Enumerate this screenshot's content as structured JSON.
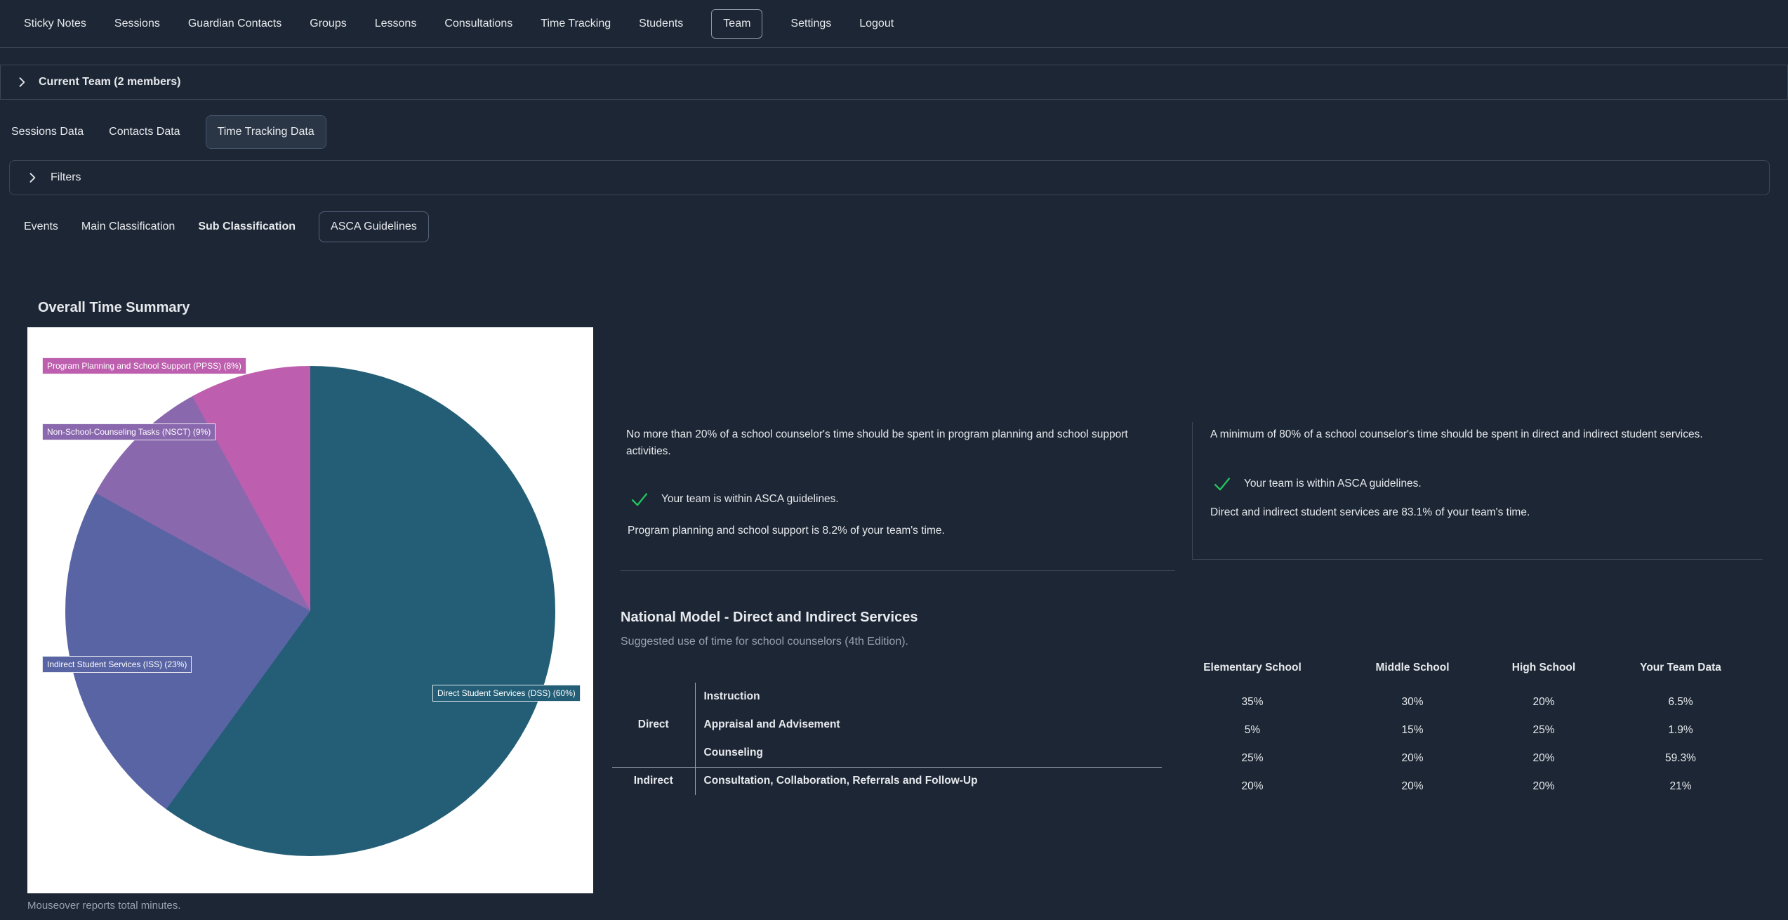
{
  "nav": {
    "items": [
      {
        "label": "Sticky Notes"
      },
      {
        "label": "Sessions"
      },
      {
        "label": "Guardian Contacts"
      },
      {
        "label": "Groups"
      },
      {
        "label": "Lessons"
      },
      {
        "label": "Consultations"
      },
      {
        "label": "Time Tracking"
      },
      {
        "label": "Students"
      },
      {
        "label": "Team",
        "active": true
      },
      {
        "label": "Settings"
      },
      {
        "label": "Logout"
      }
    ]
  },
  "team_bar": {
    "label": "Current Team (2 members)"
  },
  "data_tabs": {
    "items": [
      {
        "label": "Sessions Data"
      },
      {
        "label": "Contacts Data"
      },
      {
        "label": "Time Tracking Data",
        "active": true
      }
    ]
  },
  "filters": {
    "label": "Filters"
  },
  "sub_tabs": {
    "items": [
      {
        "label": "Events"
      },
      {
        "label": "Main Classification"
      },
      {
        "label": "Sub Classification",
        "active": true
      },
      {
        "label": "ASCA Guidelines"
      }
    ]
  },
  "overall": {
    "title": "Overall Time Summary",
    "footnote": "Mouseover reports total minutes."
  },
  "chart_data": {
    "type": "pie",
    "title": "Overall Time Summary",
    "unit": "%",
    "direction": "clockwise",
    "start_angle_deg": 0,
    "slices": [
      {
        "name": "Direct Student Services (DSS)",
        "label": "Direct Student Services (DSS) (60%)",
        "value": 60,
        "color": "#235e76"
      },
      {
        "name": "Indirect Student Services (ISS)",
        "label": "Indirect Student Services (ISS) (23%)",
        "value": 23,
        "color": "#5964a4"
      },
      {
        "name": "Non-School-Counseling Tasks (NSCT)",
        "label": "Non-School-Counseling Tasks (NSCT) (9%)",
        "value": 9,
        "color": "#8a68ae"
      },
      {
        "name": "Program Planning and School Support (PPSS)",
        "label": "Program Planning and School Support (PPSS) (8%)",
        "value": 8,
        "color": "#bd5fae"
      }
    ]
  },
  "guideline_left": {
    "rule": "No more than 20% of a school counselor's time should be spent in program planning and school support activities.",
    "status": "Your team is within ASCA guidelines.",
    "detail": "Program planning and school support is 8.2% of your team's time."
  },
  "guideline_right": {
    "rule": "A minimum of 80% of a school counselor's time should be spent in direct and indirect student services.",
    "status": "Your team is within ASCA guidelines.",
    "detail": "Direct and indirect student services are 83.1% of your team's time."
  },
  "national_model": {
    "title": "National Model - Direct and Indirect Services",
    "subtitle": "Suggested use of time for school counselors (4th Edition).",
    "categories": [
      {
        "name": "Direct",
        "services": [
          "Instruction",
          "Appraisal and Advisement",
          "Counseling"
        ]
      },
      {
        "name": "Indirect",
        "services": [
          "Consultation, Collaboration, Referrals and Follow-Up"
        ]
      }
    ]
  },
  "usage_table": {
    "columns": [
      "Elementary School",
      "Middle School",
      "High School",
      "Your Team Data"
    ],
    "rows": [
      {
        "service": "Instruction",
        "values": [
          "35%",
          "30%",
          "20%",
          "6.5%"
        ]
      },
      {
        "service": "Appraisal and Advisement",
        "values": [
          "5%",
          "15%",
          "25%",
          "1.9%"
        ]
      },
      {
        "service": "Counseling",
        "values": [
          "25%",
          "20%",
          "20%",
          "59.3%"
        ]
      },
      {
        "service": "Consultation, Collaboration, Referrals and Follow-Up",
        "values": [
          "20%",
          "20%",
          "20%",
          "21%"
        ]
      }
    ]
  },
  "colors": {
    "status_green": "#22c55e",
    "background": "#1d2634"
  }
}
